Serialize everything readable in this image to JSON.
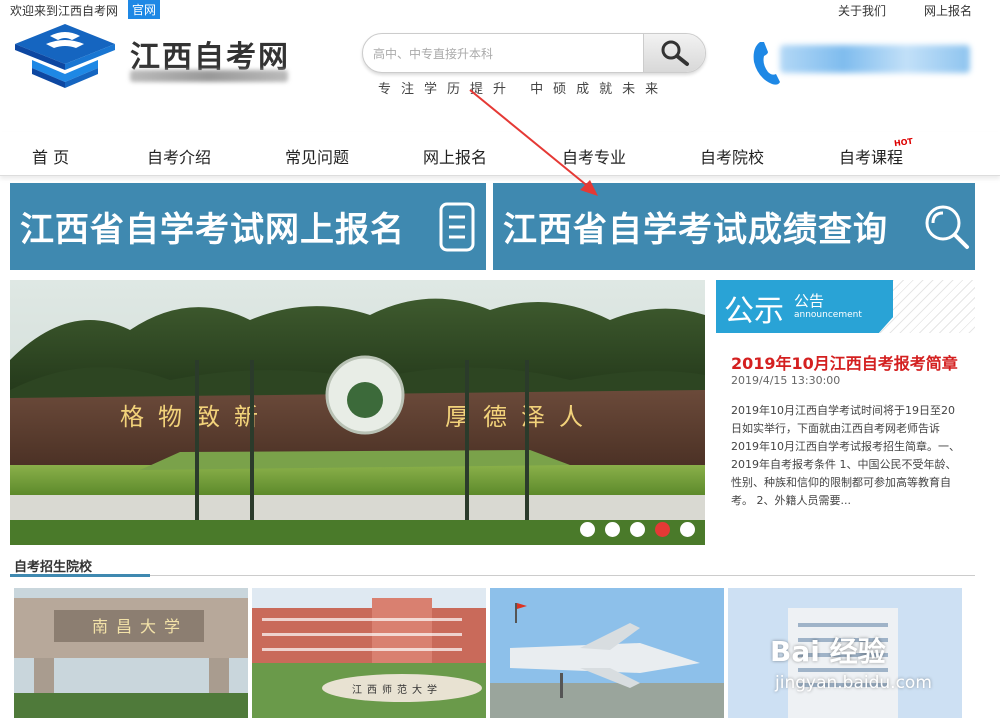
{
  "topbar": {
    "welcome": "欢迎来到江西自考网",
    "official": "官网",
    "about": "关于我们",
    "signup": "网上报名"
  },
  "header": {
    "site_title": "江西自考网",
    "search_placeholder": "高中、中专直接升本科",
    "slogan": "专注学历提升 中硕成就未来"
  },
  "nav": {
    "items": [
      "首 页",
      "自考介绍",
      "常见问题",
      "网上报名",
      "自考专业",
      "自考院校",
      "自考课程"
    ],
    "hot_badge": "HOT"
  },
  "banners": {
    "left": "江西省自学考试网上报名",
    "right": "江西省自学考试成绩查询"
  },
  "slider": {
    "gate_left": "格物致新",
    "gate_right": "厚德泽人",
    "dots_count": 5,
    "active_dot": 4
  },
  "notice": {
    "tab_big": "公示",
    "tab_small": "公告",
    "tab_en": "announcement",
    "title": "2019年10月江西自考报考简章",
    "date": "2019/4/15 13:30:00",
    "body": "2019年10月江西自学考试时间将于19日至20日如实举行，下面就由江西自考网老师告诉2019年10月江西自学考试报考招生简章。一、2019年自考报考条件 1、中国公民不受年龄、性别、种族和信仰的限制都可参加高等教育自考。 2、外籍人员需要..."
  },
  "colleges": {
    "title": "自考招生院校",
    "items": [
      "南昌大学",
      "江西师范大学",
      "",
      ""
    ]
  },
  "watermark": {
    "logo": "Bai 经验",
    "url": "jingyan.baidu.com"
  },
  "colors": {
    "banner": "#3f89b0",
    "accent_blue": "#1e88e5",
    "notice_red": "#d42020",
    "notice_tab": "#29a3d6"
  }
}
